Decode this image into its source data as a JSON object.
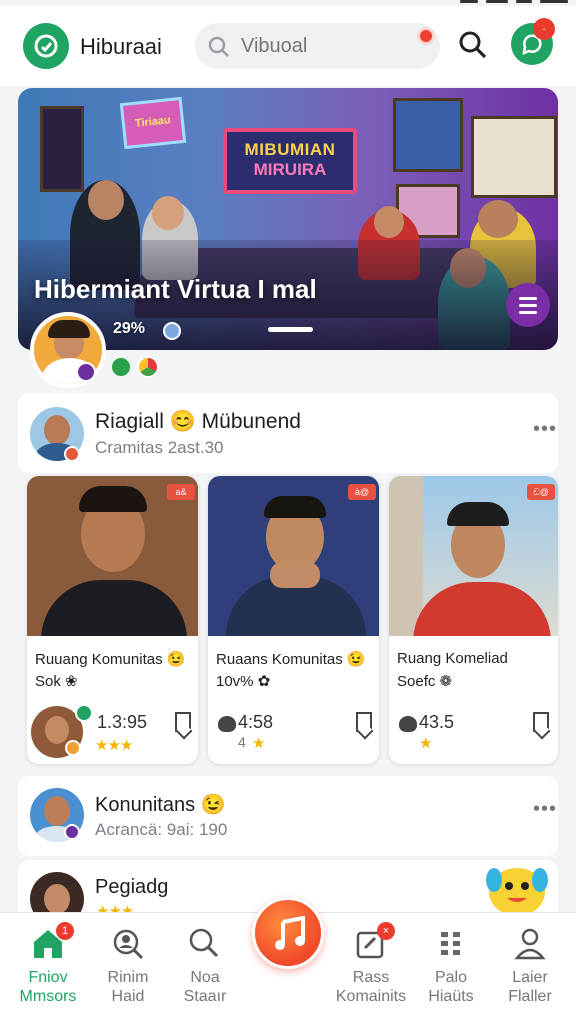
{
  "app": {
    "title": "Hiburaai"
  },
  "search": {
    "placeholder": "Vibuoal"
  },
  "header": {
    "chat_badge": "·"
  },
  "hero": {
    "sign_line1": "MIBUMIAN",
    "sign_line2": "MIRUIRA",
    "pink_sign": "Tiriaau",
    "title": "Hibermiant Virtua I mal",
    "percent": "29%"
  },
  "post": {
    "name": "Riagiall 😊 Mübunend",
    "meta": "Cramitas 2ast.30"
  },
  "cards": [
    {
      "tag": "a&",
      "title": "Ruuang Komunitas 😉",
      "sub": "Sok ❀",
      "stat": "1.3:95",
      "rating": 3
    },
    {
      "tag": "à@",
      "title": "Ruaans Komunitas 😉",
      "sub": "10v% ✿",
      "stat": "4:58",
      "sub_stat": "4",
      "rating": 1
    },
    {
      "tag": "ඩ@",
      "title": "Ruang Komeliad",
      "sub": "Soefc ❁",
      "stat": "43.5",
      "rating": 1
    }
  ],
  "rows": [
    {
      "name": "Konunitans 😉",
      "meta": "Acrancä: 9ai: 190"
    },
    {
      "name": "Pegiadg",
      "meta": ""
    }
  ],
  "nav": [
    {
      "label": "Fniov\nMmsors",
      "icon": "home-icon",
      "active": true,
      "badge": "1"
    },
    {
      "label": "Rinim\nHaid",
      "icon": "search-person-icon"
    },
    {
      "label": "Noa\nStaaır",
      "icon": "search-icon"
    },
    {
      "label": "Rass\nKomainits",
      "icon": "edit-box-icon",
      "badge": "×"
    },
    {
      "label": "Palo\nHiaüts",
      "icon": "grid-icon"
    },
    {
      "label": "Laier\nFlaller",
      "icon": "profile-icon"
    }
  ],
  "colors": {
    "brand_green": "#1fa463",
    "accent_red": "#ea3b2e",
    "purple": "#7a2da4"
  }
}
